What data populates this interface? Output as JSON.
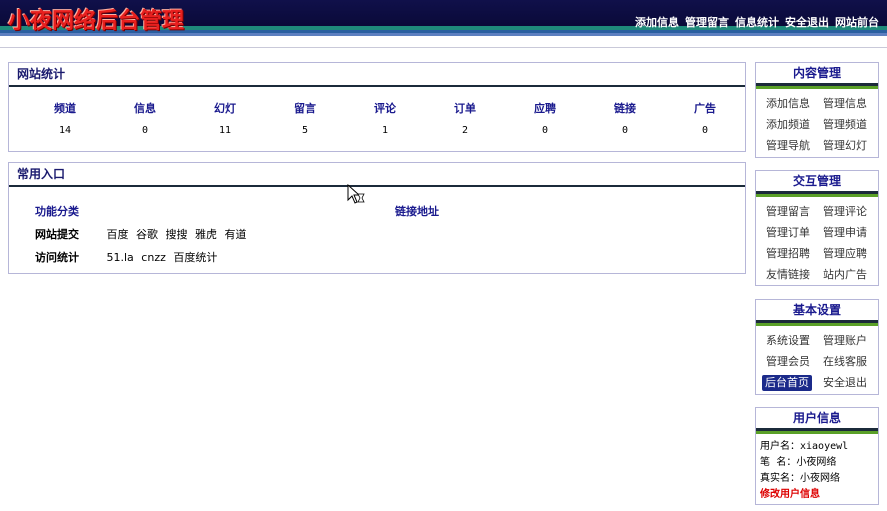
{
  "header": {
    "logo_text": "小夜网络后台管理",
    "nav": [
      "添加信息",
      "管理留言",
      "信息统计",
      "安全退出",
      "网站前台"
    ]
  },
  "stats_panel": {
    "title": "网站统计",
    "columns": [
      "频道",
      "信息",
      "幻灯",
      "留言",
      "评论",
      "订单",
      "应聘",
      "链接",
      "广告"
    ],
    "values": [
      "14",
      "0",
      "11",
      "5",
      "1",
      "2",
      "0",
      "0",
      "0"
    ]
  },
  "entry_panel": {
    "title": "常用入口",
    "col_category": "功能分类",
    "col_links": "链接地址",
    "rows": [
      {
        "label": "网站提交",
        "links": [
          "百度",
          "谷歌",
          "搜搜",
          "雅虎",
          "有道"
        ]
      },
      {
        "label": "访问统计",
        "links": [
          "51.la",
          "cnzz",
          "百度统计"
        ]
      }
    ]
  },
  "sidebar": {
    "content": {
      "title": "内容管理",
      "items": [
        "添加信息",
        "管理信息",
        "添加频道",
        "管理频道",
        "管理导航",
        "管理幻灯"
      ]
    },
    "interaction": {
      "title": "交互管理",
      "items": [
        "管理留言",
        "管理评论",
        "管理订单",
        "管理申请",
        "管理招聘",
        "管理应聘",
        "友情链接",
        "站内广告"
      ]
    },
    "settings": {
      "title": "基本设置",
      "items": [
        "系统设置",
        "管理账户",
        "管理会员",
        "在线客服",
        "后台首页",
        "安全退出"
      ],
      "active": "后台首页"
    },
    "user": {
      "title": "用户信息",
      "username_label": "用户名：",
      "username": "xiaoyewl",
      "nick_label": "笔  名：",
      "nick": "小夜网络",
      "realname_label": "真实名：",
      "realname": "小夜网络",
      "edit_link": "修改用户信息"
    }
  },
  "colors": {
    "header_bg": "#0b0b3c",
    "logo": "#e8201f",
    "title_blue": "#1a1a6e",
    "accent_green": "#5aa028",
    "link_red": "#dd0000"
  }
}
